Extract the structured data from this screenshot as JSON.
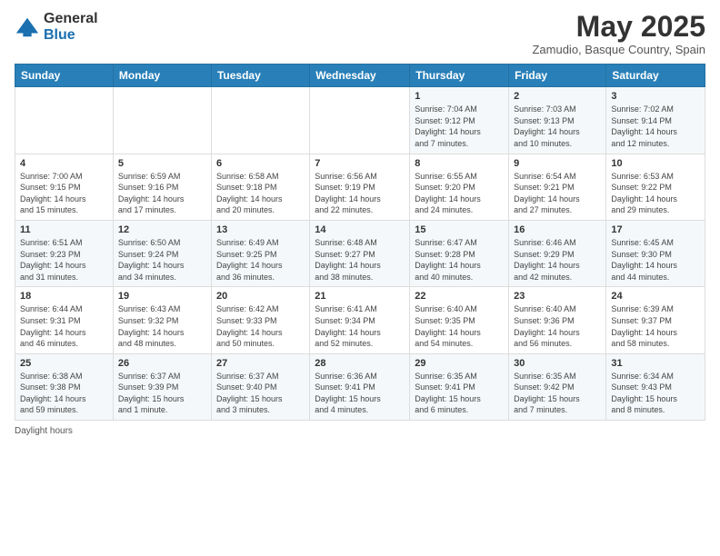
{
  "logo": {
    "general": "General",
    "blue": "Blue"
  },
  "title": "May 2025",
  "location": "Zamudio, Basque Country, Spain",
  "days_header": [
    "Sunday",
    "Monday",
    "Tuesday",
    "Wednesday",
    "Thursday",
    "Friday",
    "Saturday"
  ],
  "weeks": [
    [
      {
        "day": "",
        "info": ""
      },
      {
        "day": "",
        "info": ""
      },
      {
        "day": "",
        "info": ""
      },
      {
        "day": "",
        "info": ""
      },
      {
        "day": "1",
        "info": "Sunrise: 7:04 AM\nSunset: 9:12 PM\nDaylight: 14 hours\nand 7 minutes."
      },
      {
        "day": "2",
        "info": "Sunrise: 7:03 AM\nSunset: 9:13 PM\nDaylight: 14 hours\nand 10 minutes."
      },
      {
        "day": "3",
        "info": "Sunrise: 7:02 AM\nSunset: 9:14 PM\nDaylight: 14 hours\nand 12 minutes."
      }
    ],
    [
      {
        "day": "4",
        "info": "Sunrise: 7:00 AM\nSunset: 9:15 PM\nDaylight: 14 hours\nand 15 minutes."
      },
      {
        "day": "5",
        "info": "Sunrise: 6:59 AM\nSunset: 9:16 PM\nDaylight: 14 hours\nand 17 minutes."
      },
      {
        "day": "6",
        "info": "Sunrise: 6:58 AM\nSunset: 9:18 PM\nDaylight: 14 hours\nand 20 minutes."
      },
      {
        "day": "7",
        "info": "Sunrise: 6:56 AM\nSunset: 9:19 PM\nDaylight: 14 hours\nand 22 minutes."
      },
      {
        "day": "8",
        "info": "Sunrise: 6:55 AM\nSunset: 9:20 PM\nDaylight: 14 hours\nand 24 minutes."
      },
      {
        "day": "9",
        "info": "Sunrise: 6:54 AM\nSunset: 9:21 PM\nDaylight: 14 hours\nand 27 minutes."
      },
      {
        "day": "10",
        "info": "Sunrise: 6:53 AM\nSunset: 9:22 PM\nDaylight: 14 hours\nand 29 minutes."
      }
    ],
    [
      {
        "day": "11",
        "info": "Sunrise: 6:51 AM\nSunset: 9:23 PM\nDaylight: 14 hours\nand 31 minutes."
      },
      {
        "day": "12",
        "info": "Sunrise: 6:50 AM\nSunset: 9:24 PM\nDaylight: 14 hours\nand 34 minutes."
      },
      {
        "day": "13",
        "info": "Sunrise: 6:49 AM\nSunset: 9:25 PM\nDaylight: 14 hours\nand 36 minutes."
      },
      {
        "day": "14",
        "info": "Sunrise: 6:48 AM\nSunset: 9:27 PM\nDaylight: 14 hours\nand 38 minutes."
      },
      {
        "day": "15",
        "info": "Sunrise: 6:47 AM\nSunset: 9:28 PM\nDaylight: 14 hours\nand 40 minutes."
      },
      {
        "day": "16",
        "info": "Sunrise: 6:46 AM\nSunset: 9:29 PM\nDaylight: 14 hours\nand 42 minutes."
      },
      {
        "day": "17",
        "info": "Sunrise: 6:45 AM\nSunset: 9:30 PM\nDaylight: 14 hours\nand 44 minutes."
      }
    ],
    [
      {
        "day": "18",
        "info": "Sunrise: 6:44 AM\nSunset: 9:31 PM\nDaylight: 14 hours\nand 46 minutes."
      },
      {
        "day": "19",
        "info": "Sunrise: 6:43 AM\nSunset: 9:32 PM\nDaylight: 14 hours\nand 48 minutes."
      },
      {
        "day": "20",
        "info": "Sunrise: 6:42 AM\nSunset: 9:33 PM\nDaylight: 14 hours\nand 50 minutes."
      },
      {
        "day": "21",
        "info": "Sunrise: 6:41 AM\nSunset: 9:34 PM\nDaylight: 14 hours\nand 52 minutes."
      },
      {
        "day": "22",
        "info": "Sunrise: 6:40 AM\nSunset: 9:35 PM\nDaylight: 14 hours\nand 54 minutes."
      },
      {
        "day": "23",
        "info": "Sunrise: 6:40 AM\nSunset: 9:36 PM\nDaylight: 14 hours\nand 56 minutes."
      },
      {
        "day": "24",
        "info": "Sunrise: 6:39 AM\nSunset: 9:37 PM\nDaylight: 14 hours\nand 58 minutes."
      }
    ],
    [
      {
        "day": "25",
        "info": "Sunrise: 6:38 AM\nSunset: 9:38 PM\nDaylight: 14 hours\nand 59 minutes."
      },
      {
        "day": "26",
        "info": "Sunrise: 6:37 AM\nSunset: 9:39 PM\nDaylight: 15 hours\nand 1 minute."
      },
      {
        "day": "27",
        "info": "Sunrise: 6:37 AM\nSunset: 9:40 PM\nDaylight: 15 hours\nand 3 minutes."
      },
      {
        "day": "28",
        "info": "Sunrise: 6:36 AM\nSunset: 9:41 PM\nDaylight: 15 hours\nand 4 minutes."
      },
      {
        "day": "29",
        "info": "Sunrise: 6:35 AM\nSunset: 9:41 PM\nDaylight: 15 hours\nand 6 minutes."
      },
      {
        "day": "30",
        "info": "Sunrise: 6:35 AM\nSunset: 9:42 PM\nDaylight: 15 hours\nand 7 minutes."
      },
      {
        "day": "31",
        "info": "Sunrise: 6:34 AM\nSunset: 9:43 PM\nDaylight: 15 hours\nand 8 minutes."
      }
    ]
  ],
  "footer": "Daylight hours"
}
